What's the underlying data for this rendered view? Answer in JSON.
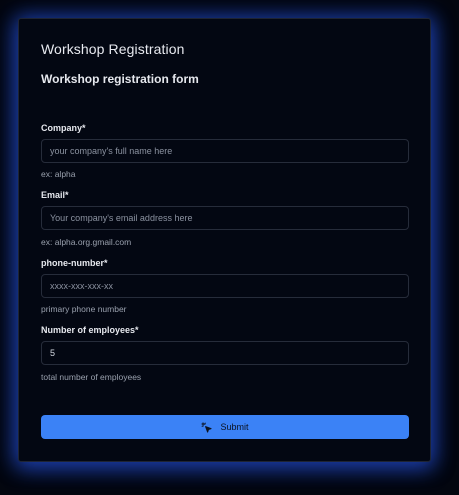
{
  "form": {
    "title": "Workshop Registration",
    "subtitle": "Workshop registration form",
    "fields": [
      {
        "label": "Company*",
        "placeholder": "your company's full name here",
        "value": "",
        "help": "ex: alpha"
      },
      {
        "label": "Email*",
        "placeholder": "Your company's email address here",
        "value": "",
        "help": "ex: alpha.org.gmail.com"
      },
      {
        "label": "phone-number*",
        "placeholder": "xxxx-xxx-xxx-xx",
        "value": "",
        "help": "primary phone number"
      },
      {
        "label": "Number of employees*",
        "placeholder": "",
        "value": "5",
        "help": "total number of employees"
      }
    ],
    "submit_label": "Submit",
    "submit_icon": "sparkle-cursor-icon",
    "colors": {
      "background": "#03060f",
      "card": "#030712",
      "accent": "#3b82f6",
      "glow": "#2554e6"
    }
  }
}
